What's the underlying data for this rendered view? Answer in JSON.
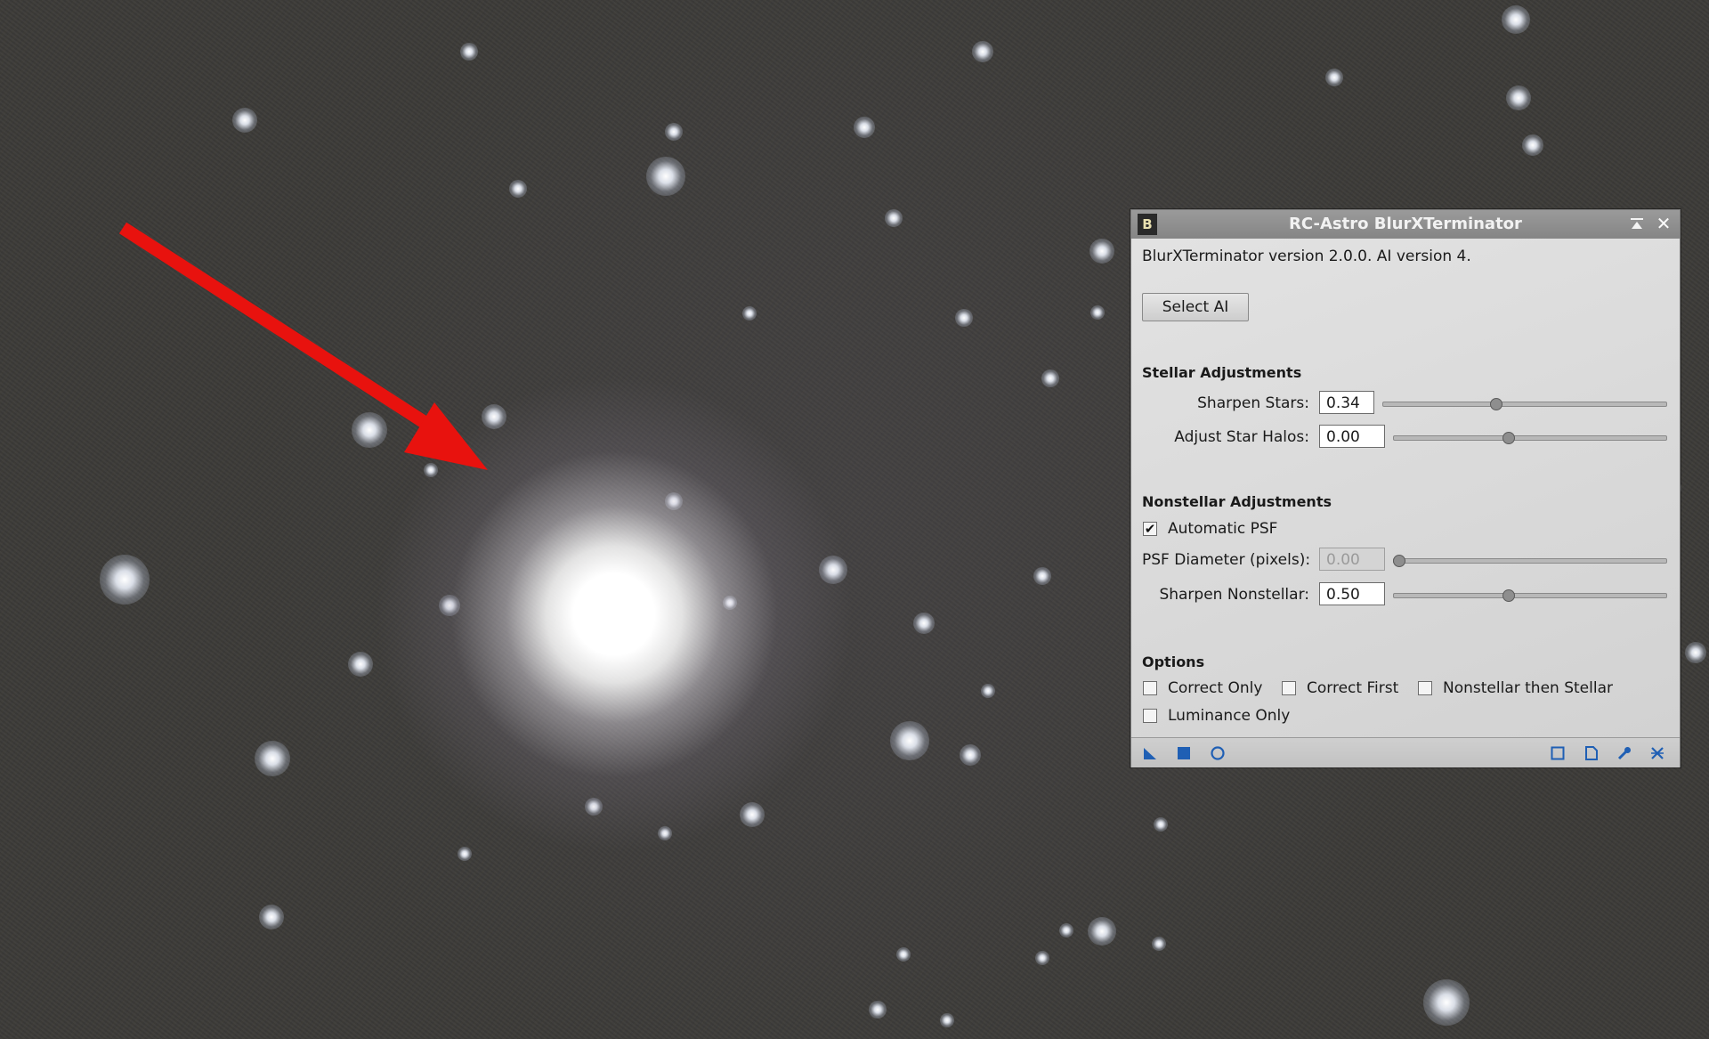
{
  "window": {
    "app_badge": "B",
    "title": "RC-Astro BlurXTerminator"
  },
  "dialog": {
    "version_text": "BlurXTerminator version 2.0.0. AI version 4.",
    "select_ai_label": "Select AI",
    "stellar": {
      "heading": "Stellar Adjustments",
      "sharpen_stars": {
        "label": "Sharpen Stars:",
        "value": "0.34",
        "slider_fraction": 0.34
      },
      "adjust_halos": {
        "label": "Adjust Star Halos:",
        "value": "0.00",
        "slider_fraction": 0.5
      }
    },
    "nonstellar": {
      "heading": "Nonstellar Adjustments",
      "automatic_psf": {
        "label": "Automatic PSF",
        "checked": true
      },
      "psf_diameter": {
        "label": "PSF Diameter (pixels):",
        "value": "0.00",
        "enabled": false,
        "slider_fraction": 0.0
      },
      "sharpen_nonstellar": {
        "label": "Sharpen Nonstellar:",
        "value": "0.50",
        "slider_fraction": 0.5
      }
    },
    "options": {
      "heading": "Options",
      "correct_only": {
        "label": "Correct Only",
        "checked": false
      },
      "correct_first": {
        "label": "Correct First",
        "checked": false
      },
      "nonstellar_then_stellar": {
        "label": "Nonstellar then Stellar",
        "checked": false
      },
      "luminance_only": {
        "label": "Luminance Only",
        "checked": false
      }
    },
    "toolbar_icons": [
      "new-instance-icon",
      "apply-icon",
      "apply-global-icon",
      "preview-icon",
      "documentation-icon",
      "settings-icon",
      "reset-icon"
    ]
  },
  "colors": {
    "arrow": "#e8120e",
    "icon_blue": "#1f5fb4"
  }
}
